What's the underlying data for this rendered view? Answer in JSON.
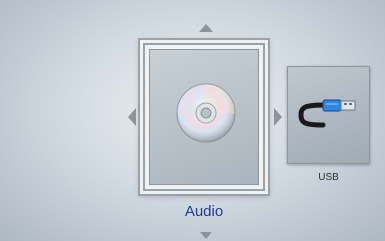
{
  "menu": {
    "selected_item": {
      "label": "Audio",
      "icon": "disc-icon"
    },
    "side_item": {
      "label": "USB",
      "icon": "usb-cable-icon"
    }
  },
  "colors": {
    "selected_label": "#1b3a9a",
    "side_label": "#2a2f35",
    "arrow": "#8d949b",
    "usb_plug": "#1e6fd0"
  }
}
